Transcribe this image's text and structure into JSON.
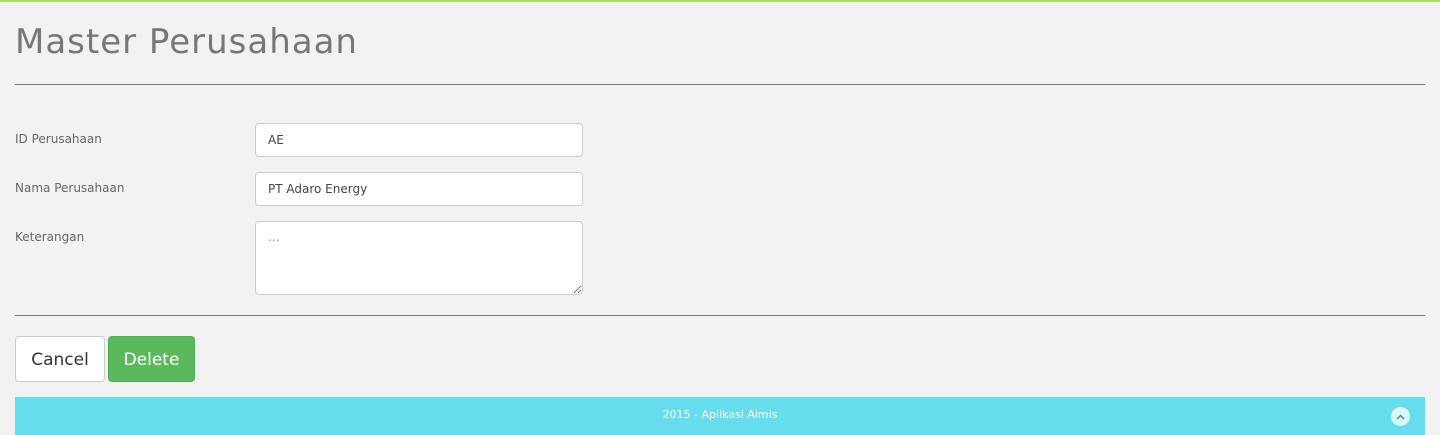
{
  "page": {
    "title": "Master Perusahaan"
  },
  "form": {
    "id_label": "ID Perusahaan",
    "id_value": "AE",
    "nama_label": "Nama Perusahaan",
    "nama_value": "PT Adaro Energy",
    "keterangan_label": "Keterangan",
    "keterangan_placeholder": "..."
  },
  "actions": {
    "cancel_label": "Cancel",
    "delete_label": "Delete"
  },
  "footer": {
    "text": "2015 - Aplikasi Almis",
    "scroll_top_icon": "chevron-up-icon"
  },
  "colors": {
    "accent_top_line": "#a6e34f",
    "delete_button": "#5cb85c",
    "footer_bg": "#66dced"
  }
}
